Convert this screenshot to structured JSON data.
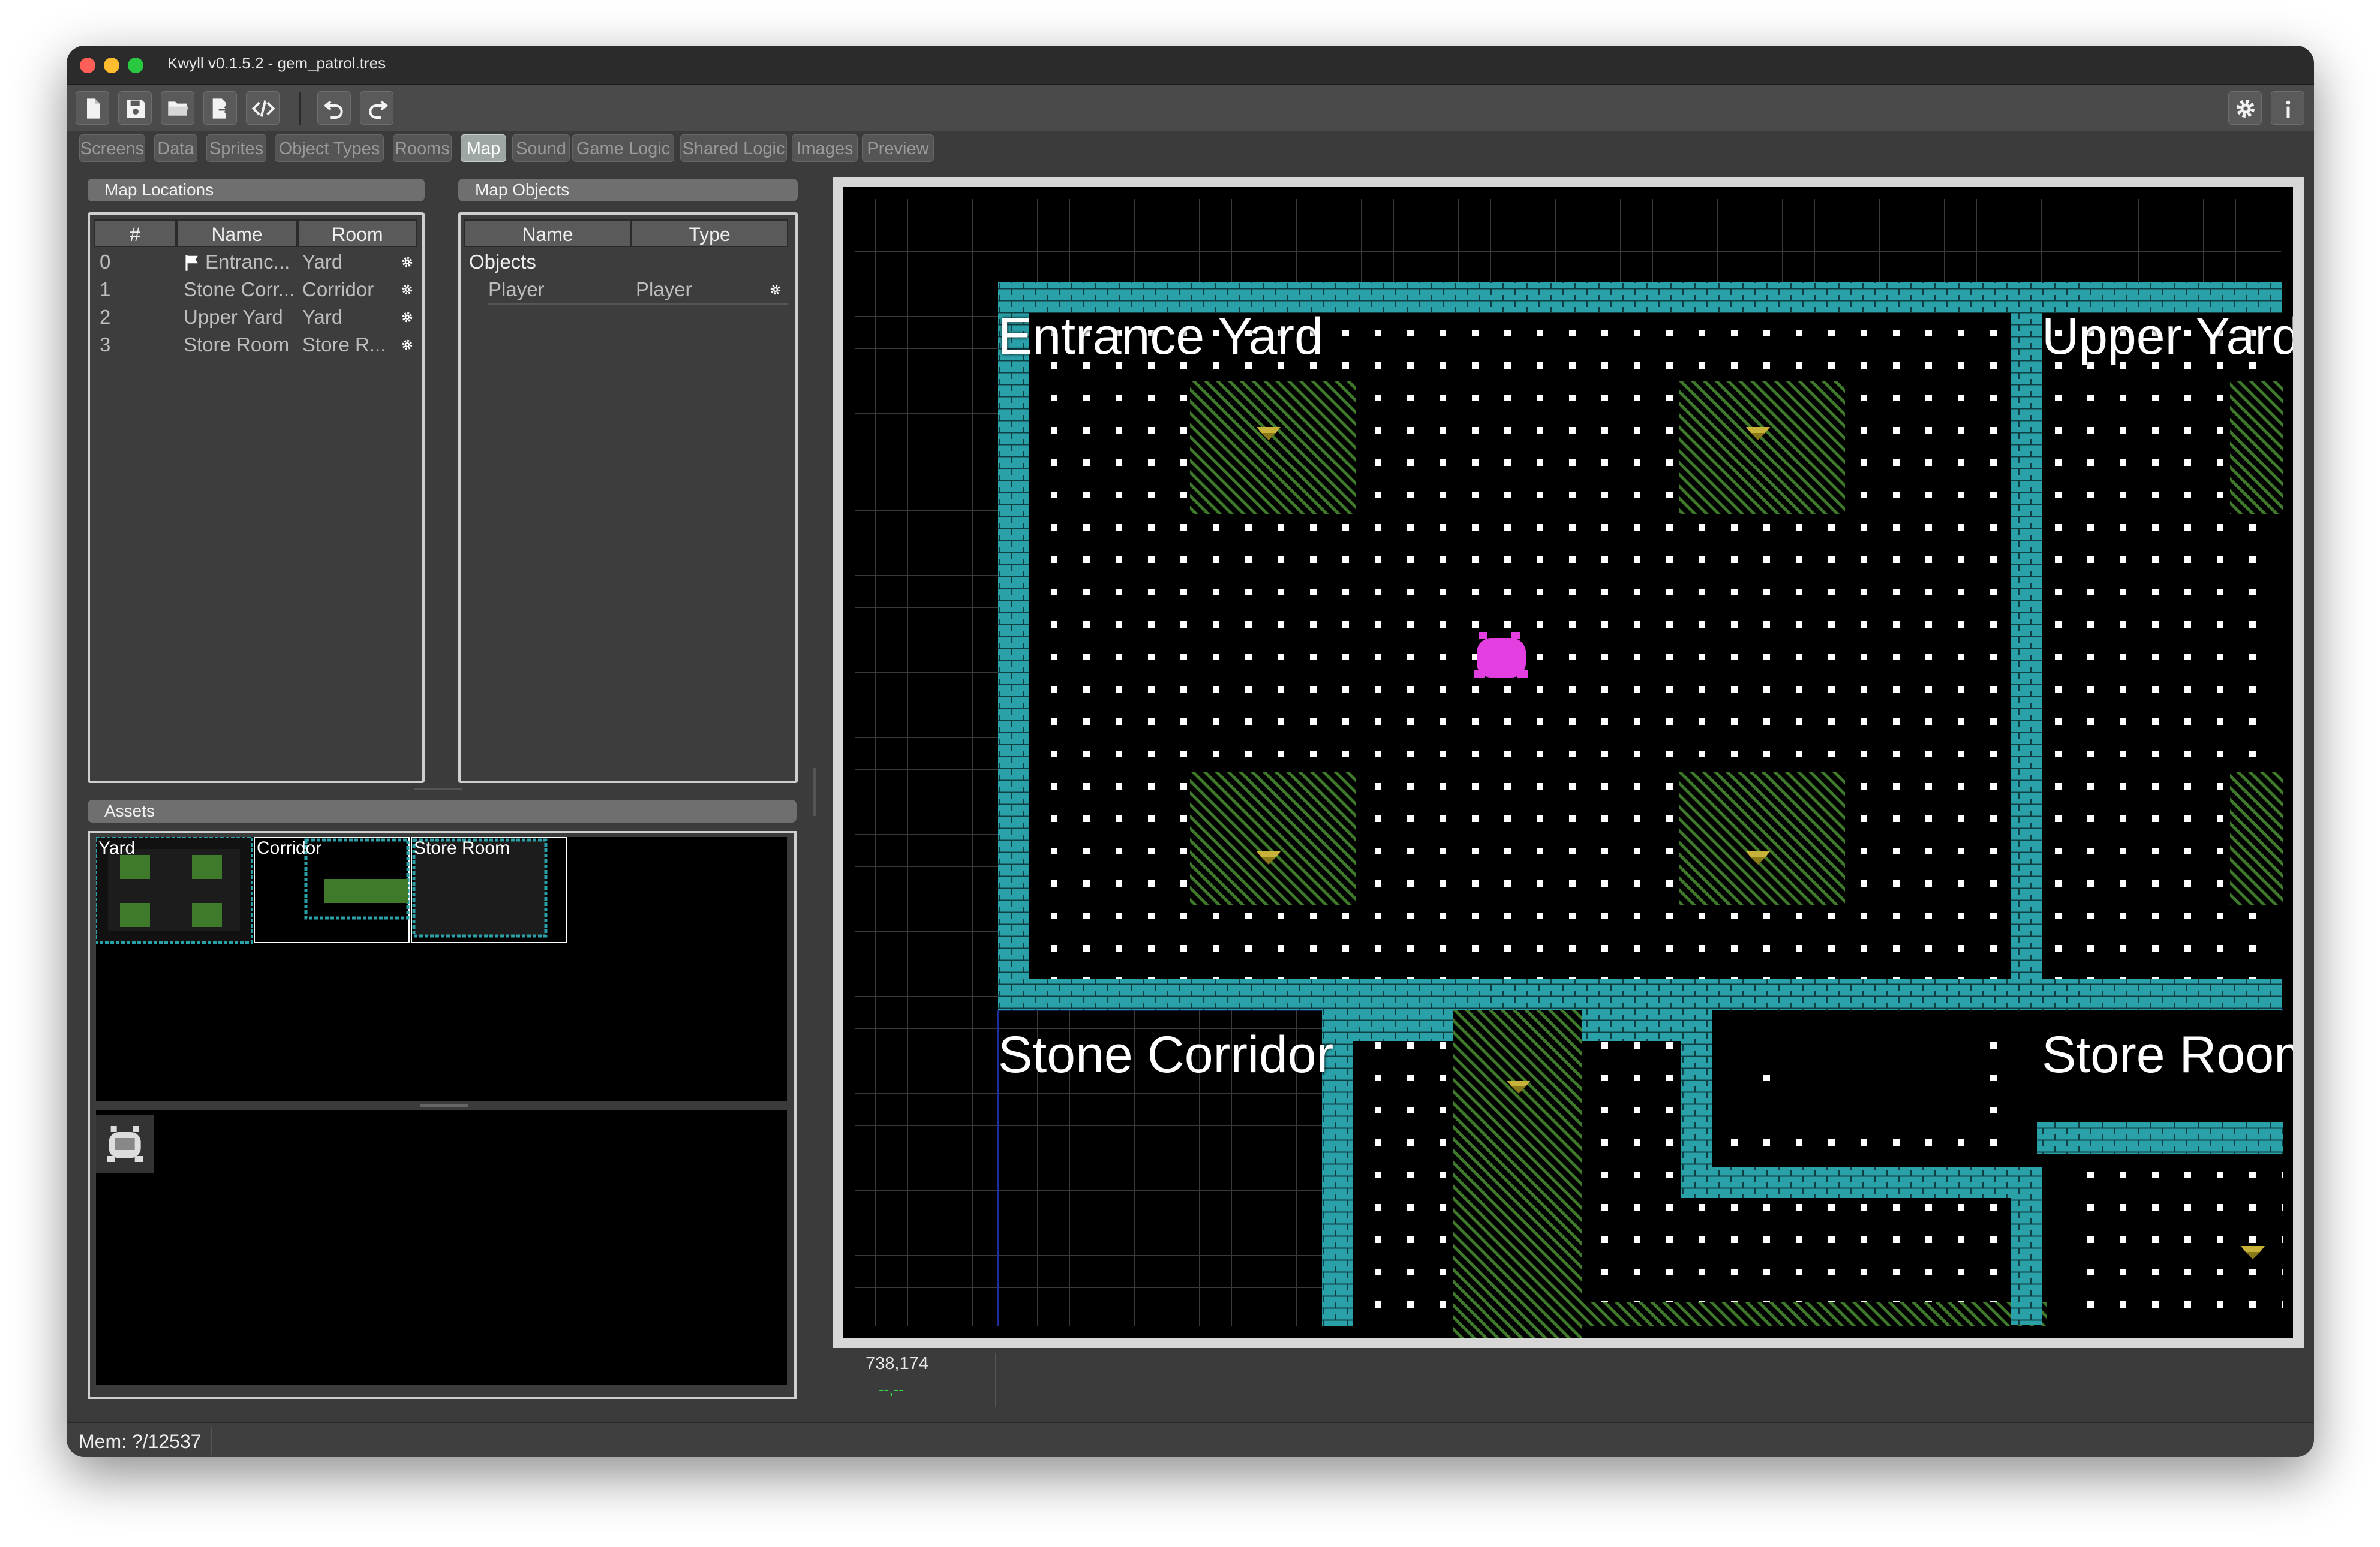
{
  "window": {
    "title": "Kwyll v0.1.5.2 - gem_patrol.tres",
    "traffic_lights": {
      "close": "#ff5f57",
      "minimize": "#febc2e",
      "zoom": "#28c840"
    }
  },
  "toolbar": {
    "left_icons": [
      "new-file-icon",
      "save-icon",
      "open-folder-icon",
      "export-icon",
      "code-icon",
      "undo-icon",
      "redo-icon"
    ],
    "right_icons": [
      "settings-gear-icon",
      "info-icon"
    ]
  },
  "tabs": [
    "Screens",
    "Data",
    "Sprites",
    "Object Types",
    "Rooms",
    "Map",
    "Sound",
    "Game Logic",
    "Shared Logic",
    "Images",
    "Preview"
  ],
  "active_tab": "Map",
  "map_locations": {
    "title": "Map Locations",
    "columns": [
      "#",
      "Name",
      "Room"
    ],
    "rows": [
      {
        "index": "0",
        "name": "Entranc...",
        "room": "Yard",
        "start": true
      },
      {
        "index": "1",
        "name": "Stone Corr...",
        "room": "Corridor",
        "start": false
      },
      {
        "index": "2",
        "name": "Upper Yard",
        "room": "Yard",
        "start": false
      },
      {
        "index": "3",
        "name": "Store Room",
        "room": "Store R...",
        "start": false
      }
    ]
  },
  "map_objects": {
    "title": "Map Objects",
    "columns": [
      "Name",
      "Type"
    ],
    "group": "Objects",
    "rows": [
      {
        "name": "Player",
        "type": "Player"
      }
    ]
  },
  "assets": {
    "title": "Assets",
    "rooms": [
      "Yard",
      "Corridor",
      "Store Room"
    ]
  },
  "map": {
    "labels": [
      "Entrance Yard",
      "Upper Yard",
      "Stone Corridor",
      "Store Room"
    ],
    "colors": {
      "wall": "#2aa0a8",
      "hatch": "#3f7a2a",
      "dot": "#ffffff",
      "player": "#e23ee0",
      "gem": "#c9b23a"
    }
  },
  "coords": {
    "value": "738,174",
    "sub": "--,--"
  },
  "status": {
    "memory": "Mem: ?/12537"
  }
}
